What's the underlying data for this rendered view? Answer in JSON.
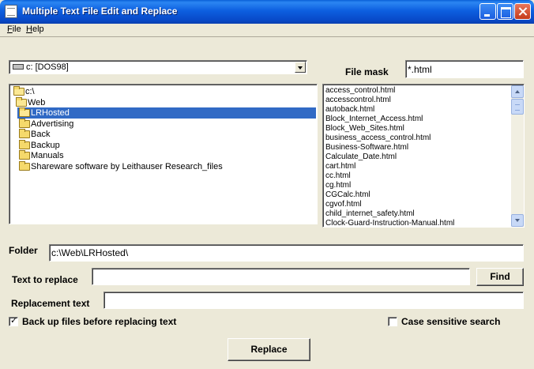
{
  "window": {
    "title": "Multiple Text File Edit and Replace"
  },
  "menu": {
    "file": "File",
    "help": "Help"
  },
  "drive": {
    "value": "c: [DOS98]"
  },
  "file_mask": {
    "label": "File mask",
    "value": "*.html"
  },
  "tree": [
    {
      "label": "c:\\",
      "indent": 0,
      "selected": false,
      "open": true
    },
    {
      "label": "Web",
      "indent": 1,
      "selected": false,
      "open": true
    },
    {
      "label": "LRHosted",
      "indent": 2,
      "selected": true,
      "open": true
    },
    {
      "label": "Advertising",
      "indent": 3,
      "selected": false,
      "open": false
    },
    {
      "label": "Back",
      "indent": 3,
      "selected": false,
      "open": false
    },
    {
      "label": "Backup",
      "indent": 3,
      "selected": false,
      "open": false
    },
    {
      "label": "Manuals",
      "indent": 3,
      "selected": false,
      "open": false
    },
    {
      "label": "Shareware software by Leithauser Research_files",
      "indent": 3,
      "selected": false,
      "open": false
    }
  ],
  "files": [
    "access_control.html",
    "accesscontrol.html",
    "autoback.html",
    "Block_Internet_Access.html",
    "Block_Web_Sites.html",
    "business_access_control.html",
    "Business-Software.html",
    "Calculate_Date.html",
    "cart.html",
    "cc.html",
    "cg.html",
    "CGCalc.html",
    "cgvof.html",
    "child_internet_safety.html",
    "Clock-Guard-Instruction-Manual.html"
  ],
  "folder": {
    "label": "Folder",
    "value": "c:\\Web\\LRHosted\\"
  },
  "text_to_replace": {
    "label": "Text to replace",
    "value": ""
  },
  "replacement_text": {
    "label": "Replacement text",
    "value": ""
  },
  "find_button": "Find",
  "backup_checkbox": {
    "label": "Back up files before replacing text",
    "checked": true
  },
  "case_checkbox": {
    "label": "Case sensitive search",
    "checked": false
  },
  "replace_button": "Replace",
  "colors": {
    "title_bar": "#0a5fd8",
    "selection": "#316ac5",
    "window_bg": "#ece9d8"
  }
}
